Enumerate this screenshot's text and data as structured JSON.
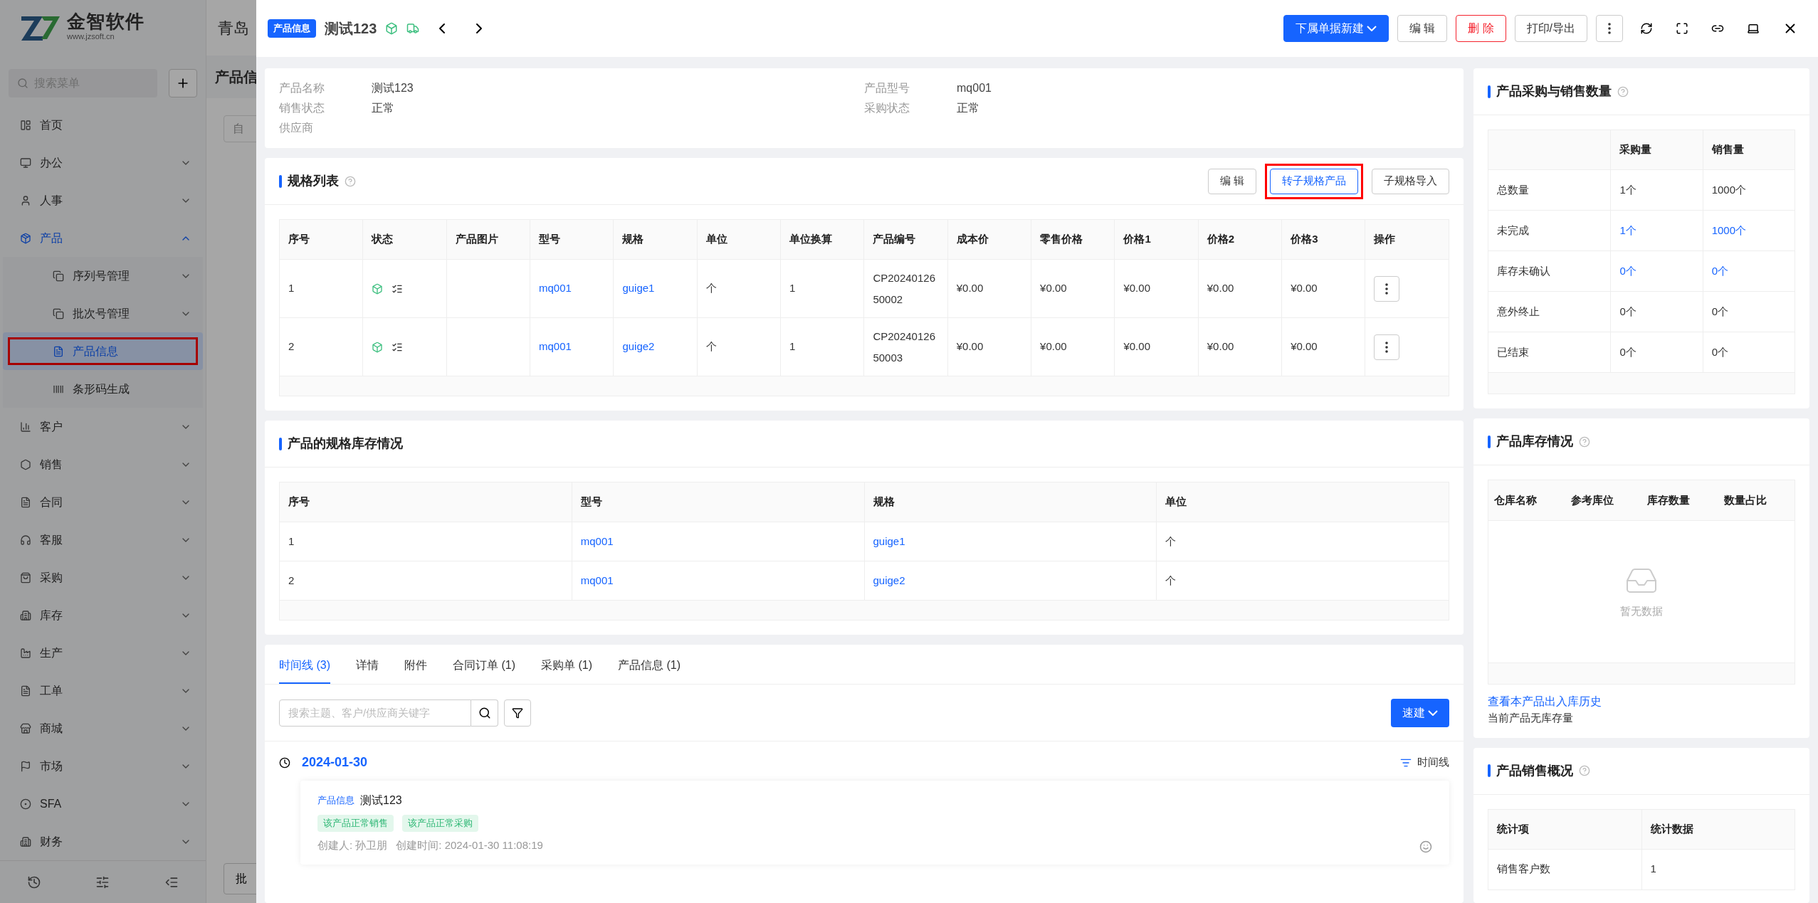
{
  "logo": {
    "name": "金智软件",
    "url": "www.jzsoft.cn"
  },
  "sidebar": {
    "search": {
      "placeholder": "搜索菜单"
    },
    "items": [
      {
        "label": "首页",
        "expandable": false,
        "expanded": false,
        "selected": false
      },
      {
        "label": "办公",
        "expandable": true,
        "expanded": false,
        "selected": false
      },
      {
        "label": "人事",
        "expandable": true,
        "expanded": false,
        "selected": false
      },
      {
        "label": "产品",
        "expandable": true,
        "expanded": true,
        "selected": false,
        "children": [
          {
            "label": "序列号管理",
            "expandable": true,
            "selected": false,
            "highlighted": false
          },
          {
            "label": "批次号管理",
            "expandable": true,
            "selected": false,
            "highlighted": false
          },
          {
            "label": "产品信息",
            "expandable": false,
            "selected": true,
            "highlighted": true
          },
          {
            "label": "条形码生成",
            "expandable": false,
            "selected": false,
            "highlighted": false
          }
        ]
      },
      {
        "label": "客户",
        "expandable": true,
        "expanded": false,
        "selected": false
      },
      {
        "label": "销售",
        "expandable": true,
        "expanded": false,
        "selected": false
      },
      {
        "label": "合同",
        "expandable": true,
        "expanded": false,
        "selected": false
      },
      {
        "label": "客服",
        "expandable": true,
        "expanded": false,
        "selected": false
      },
      {
        "label": "采购",
        "expandable": true,
        "expanded": false,
        "selected": false
      },
      {
        "label": "库存",
        "expandable": true,
        "expanded": false,
        "selected": false
      },
      {
        "label": "生产",
        "expandable": true,
        "expanded": false,
        "selected": false
      },
      {
        "label": "工单",
        "expandable": true,
        "expanded": false,
        "selected": false
      },
      {
        "label": "商城",
        "expandable": true,
        "expanded": false,
        "selected": false
      },
      {
        "label": "市场",
        "expandable": true,
        "expanded": false,
        "selected": false
      },
      {
        "label": "SFA",
        "expandable": true,
        "expanded": false,
        "selected": false
      },
      {
        "label": "财务",
        "expandable": true,
        "expanded": false,
        "selected": false
      }
    ]
  },
  "background": {
    "header_title": "青岛",
    "page_title": "产品信",
    "filter_value": "自",
    "bottom_button": "批"
  },
  "drawer": {
    "badge": "产品信息",
    "title": "测试123",
    "actions": [
      {
        "label": "下属单据新建",
        "kind": "primary"
      },
      {
        "label": "编 辑",
        "kind": "default"
      },
      {
        "label": "删 除",
        "kind": "danger"
      },
      {
        "label": "打印/导出",
        "kind": "default"
      }
    ]
  },
  "info": {
    "fields": [
      {
        "label": "产品名称",
        "value": "测试123"
      },
      {
        "label": "产品型号",
        "value": "mq001"
      },
      {
        "label": "销售状态",
        "value": "正常"
      },
      {
        "label": "采购状态",
        "value": "正常"
      },
      {
        "label": "供应商"
      }
    ]
  },
  "spec_list": {
    "title": "规格列表",
    "buttons": [
      {
        "label": "编 辑",
        "highlighted": false
      },
      {
        "label": "转子规格产品",
        "highlighted": true
      },
      {
        "label": "子规格导入",
        "highlighted": false
      }
    ],
    "columns": [
      "序号",
      "状态",
      "产品图片",
      "型号",
      "规格",
      "单位",
      "单位换算",
      "产品编号",
      "成本价",
      "零售价格",
      "价格1",
      "价格2",
      "价格3",
      "操作"
    ],
    "rows": [
      {
        "index": "1",
        "model": "mq001",
        "spec": "guige1",
        "unit": "个",
        "conversion": "1",
        "code": "CP2024012650002",
        "cost": "¥0.00",
        "retail": "¥0.00",
        "price1": "¥0.00",
        "price2": "¥0.00",
        "price3": "¥0.00"
      },
      {
        "index": "2",
        "model": "mq001",
        "spec": "guige2",
        "unit": "个",
        "conversion": "1",
        "code": "CP2024012650003",
        "cost": "¥0.00",
        "retail": "¥0.00",
        "price1": "¥0.00",
        "price2": "¥0.00",
        "price3": "¥0.00"
      }
    ]
  },
  "spec_stock": {
    "title": "产品的规格库存情况",
    "columns": [
      "序号",
      "型号",
      "规格",
      "单位"
    ],
    "rows": [
      {
        "index": "1",
        "model": "mq001",
        "spec": "guige1",
        "unit": "个"
      },
      {
        "index": "2",
        "model": "mq001",
        "spec": "guige2",
        "unit": "个"
      }
    ]
  },
  "timeline": {
    "tabs": [
      {
        "label": "时间线 (3)",
        "selected": true
      },
      {
        "label": "详情",
        "selected": false
      },
      {
        "label": "附件",
        "selected": false
      },
      {
        "label": "合同订单 (1)",
        "selected": false
      },
      {
        "label": "采购单 (1)",
        "selected": false
      },
      {
        "label": "产品信息 (1)",
        "selected": false
      }
    ],
    "search": {
      "placeholder": "搜索主题、客户/供应商关键字"
    },
    "quick_button": "速建",
    "date": "2024-01-30",
    "view_toggle": "时间线",
    "entries": [
      {
        "type_tag": "产品信息",
        "title": "测试123",
        "tags": [
          "该产品正常销售",
          "该产品正常采购"
        ],
        "creator": "创建人: 孙卫朋",
        "created": "创建时间: 2024-01-30 11:08:19"
      }
    ]
  },
  "purchase_sales": {
    "title": "产品采购与销售数量",
    "columns": [
      "采购量",
      "销售量"
    ],
    "rows": [
      {
        "label": "总数量",
        "purchase": "1个",
        "sales": "1000个",
        "link": false
      },
      {
        "label": "未完成",
        "purchase": "1个",
        "sales": "1000个",
        "link": true
      },
      {
        "label": "库存未确认",
        "purchase": "0个",
        "sales": "0个",
        "link": true
      },
      {
        "label": "意外终止",
        "purchase": "0个",
        "sales": "0个",
        "link": false
      },
      {
        "label": "已结束",
        "purchase": "0个",
        "sales": "0个",
        "link": false
      }
    ]
  },
  "inventory": {
    "title": "产品库存情况",
    "columns": [
      "仓库名称",
      "参考库位",
      "库存数量",
      "数量占比"
    ],
    "empty": "暂无数据",
    "history_link": "查看本产品出入库历史",
    "note": "当前产品无库存量"
  },
  "sales_overview": {
    "title": "产品销售概况",
    "columns": [
      "统计项",
      "统计数据"
    ],
    "rows": [
      {
        "label": "销售客户数",
        "value": "1"
      }
    ]
  }
}
